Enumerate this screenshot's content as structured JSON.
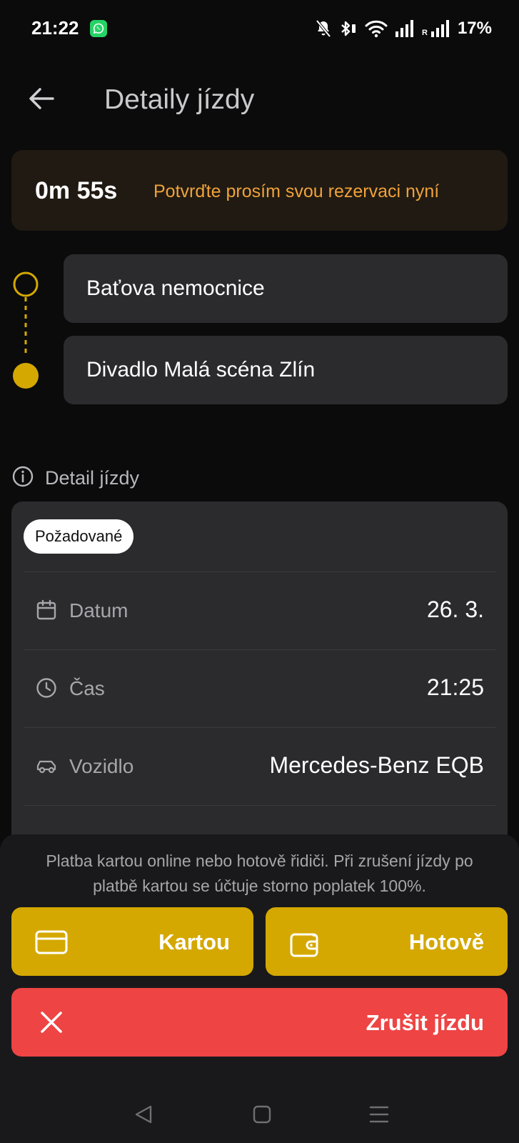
{
  "status_bar": {
    "time": "21:22",
    "roaming": "R",
    "battery": "17%",
    "icons": [
      "whatsapp-icon",
      "bell-off-icon",
      "bluetooth-icon",
      "wifi-icon",
      "signal-icon",
      "signal-icon"
    ]
  },
  "header": {
    "title": "Detaily jízdy",
    "back_icon": "arrow-left-icon"
  },
  "timer": {
    "countdown": "0m 55s",
    "message": "Potvrďte prosím svou rezervaci nyní"
  },
  "route": {
    "from": "Baťova nemocnice",
    "to": "Divadlo Malá scéna Zlín"
  },
  "details": {
    "section_title": "Detail jízdy",
    "status_chip": "Požadované",
    "rows": [
      {
        "label": "Datum",
        "value": "26. 3.",
        "icon": "calendar-icon"
      },
      {
        "label": "Čas",
        "value": "21:25",
        "icon": "clock-icon"
      },
      {
        "label": "Vozidlo",
        "value": "Mercedes-Benz EQB",
        "icon": "car-icon"
      }
    ]
  },
  "payment": {
    "note": "Platba kartou online nebo hotově řidiči. Při zrušení jízdy po platbě kartou se účtuje storno poplatek 100%.",
    "card_label": "Kartou",
    "cash_label": "Hotově",
    "cancel_label": "Zrušit jízdu"
  },
  "colors": {
    "accent_yellow": "#d4a800",
    "warning_orange": "#f0a23a",
    "danger_red": "#ee4444",
    "surface": "#2b2b2e",
    "background": "#0b0b0c"
  }
}
